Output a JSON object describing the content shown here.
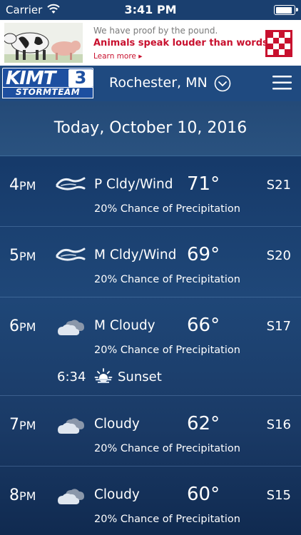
{
  "status_bar": {
    "carrier": "Carrier",
    "time": "3:41 PM"
  },
  "ad": {
    "line1": "We have proof by the pound.",
    "line2": "Animals speak louder than words.",
    "line3": "Learn more ▸"
  },
  "header": {
    "logo_kimt": "KIMT",
    "logo_number": "3",
    "logo_stormteam": "STORMTEAM",
    "location": "Rochester, MN"
  },
  "date_title": "Today, October 10, 2016",
  "hours": [
    {
      "hour": "4",
      "ampm": "PM",
      "icon": "wind-icon",
      "condition": "P Cldy/Wind",
      "temp": "71°",
      "wind": "S21",
      "precip": "20% Chance of Precipitation"
    },
    {
      "hour": "5",
      "ampm": "PM",
      "icon": "wind-icon",
      "condition": "M Cldy/Wind",
      "temp": "69°",
      "wind": "S20",
      "precip": "20% Chance of Precipitation"
    },
    {
      "hour": "6",
      "ampm": "PM",
      "icon": "cloud-icon",
      "condition": "M Cloudy",
      "temp": "66°",
      "wind": "S17",
      "precip": "20% Chance of Precipitation",
      "sunset": {
        "time": "6:34",
        "label": "Sunset"
      }
    },
    {
      "hour": "7",
      "ampm": "PM",
      "icon": "cloud-icon",
      "condition": "Cloudy",
      "temp": "62°",
      "wind": "S16",
      "precip": "20% Chance of Precipitation"
    },
    {
      "hour": "8",
      "ampm": "PM",
      "icon": "cloud-icon",
      "condition": "Cloudy",
      "temp": "60°",
      "wind": "S15",
      "precip": "20% Chance of Precipitation"
    }
  ],
  "colors": {
    "background": "#163a6a",
    "header": "#1f4a80",
    "logo_blue": "#1d4fa0",
    "ad_red": "#c8102e"
  }
}
